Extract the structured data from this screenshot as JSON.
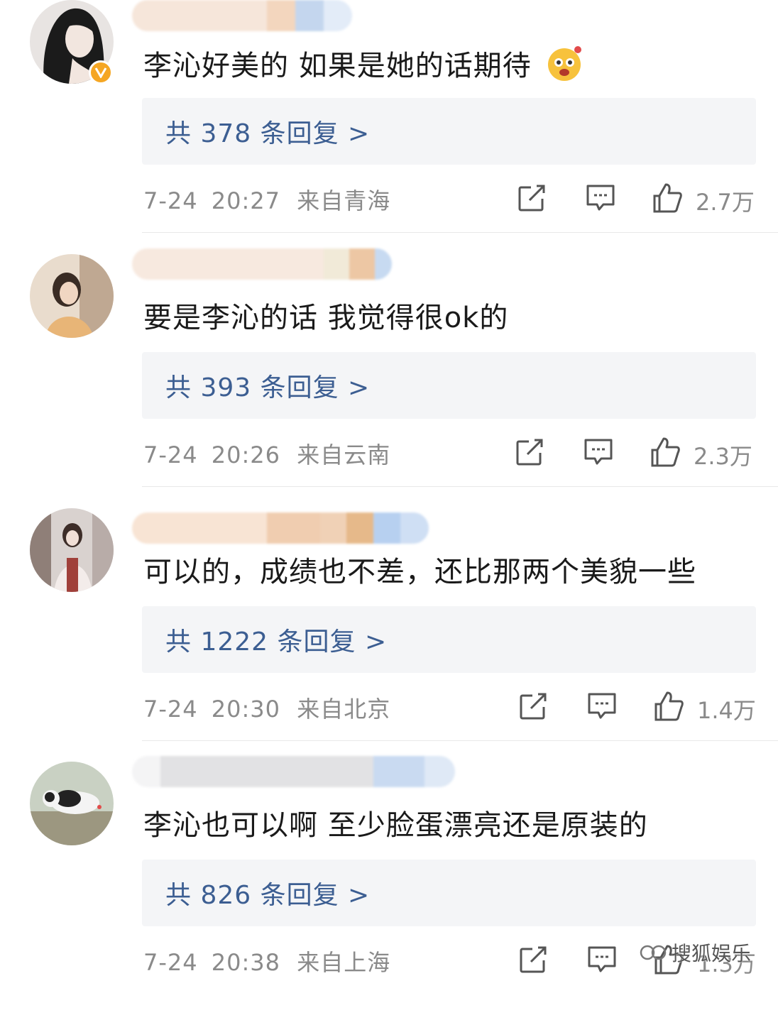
{
  "comments": [
    {
      "text": "李沁好美的 如果是她的话期待",
      "replies_label": "共 378 条回复 >",
      "date": "7-24",
      "time": "20:27",
      "location": "来自青海",
      "likes": "2.7万",
      "verified": true,
      "emoji": "smile-emoji"
    },
    {
      "text": "要是李沁的话 我觉得很ok的",
      "replies_label": "共 393 条回复 >",
      "date": "7-24",
      "time": "20:26",
      "location": "来自云南",
      "likes": "2.3万",
      "verified": false
    },
    {
      "text": "可以的，成绩也不差，还比那两个美貌一些",
      "replies_label": "共 1222 条回复 >",
      "date": "7-24",
      "time": "20:30",
      "location": "来自北京",
      "likes": "1.4万",
      "verified": false
    },
    {
      "text": "李沁也可以啊  至少脸蛋漂亮还是原装的",
      "replies_label": "共 826 条回复 >",
      "date": "7-24",
      "time": "20:38",
      "location": "来自上海",
      "likes": "1.3万",
      "verified": false
    }
  ],
  "icons": {
    "share": "share-icon",
    "comment": "comment-icon",
    "like": "thumbs-up-icon",
    "verified": "verified-badge-icon"
  },
  "watermark": "搜狐娱乐",
  "colors": {
    "reply_link": "#3c5e92",
    "reply_box_bg": "#f4f5f7",
    "meta_text": "#8a8a8a",
    "verified_badge": "#f5a623"
  }
}
